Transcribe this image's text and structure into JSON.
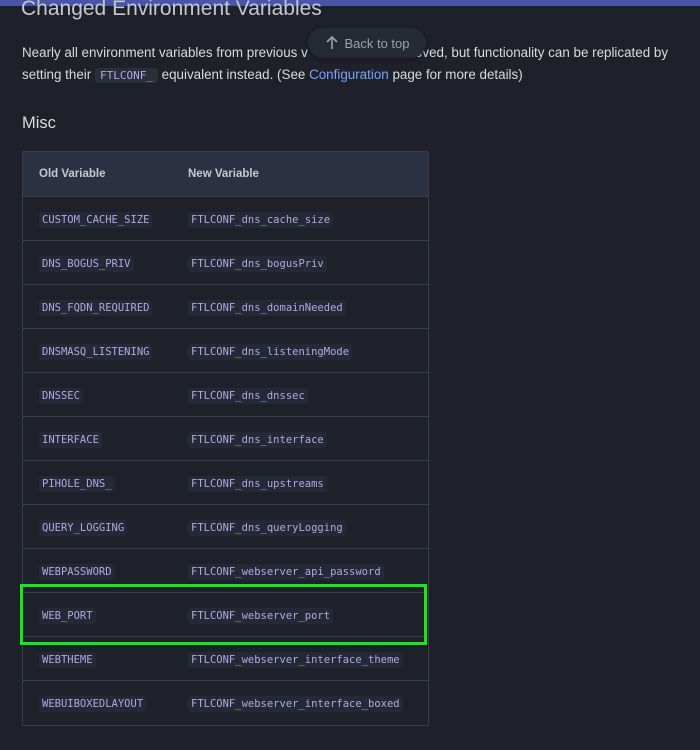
{
  "heading_partial": "Changed Environment Variables",
  "intro": {
    "text_before_code": "Nearly all environment variables from previous v",
    "text_hidden_tail": "moved, but functionality can be replicated by",
    "line2_prefix": "setting their ",
    "code": "FTLCONF_",
    "line2_mid": " equivalent instead. (See ",
    "link": "Configuration",
    "line2_suffix": " page for more details)"
  },
  "back_to_top": {
    "label": "Back to top",
    "icon": "arrow-up-icon"
  },
  "section_title": "Misc",
  "table": {
    "headers": [
      "Old Variable",
      "New Variable"
    ],
    "rows": [
      [
        "CUSTOM_CACHE_SIZE",
        "FTLCONF_dns_cache_size"
      ],
      [
        "DNS_BOGUS_PRIV",
        "FTLCONF_dns_bogusPriv"
      ],
      [
        "DNS_FQDN_REQUIRED",
        "FTLCONF_dns_domainNeeded"
      ],
      [
        "DNSMASQ_LISTENING",
        "FTLCONF_dns_listeningMode"
      ],
      [
        "DNSSEC",
        "FTLCONF_dns_dnssec"
      ],
      [
        "INTERFACE",
        "FTLCONF_dns_interface"
      ],
      [
        "PIHOLE_DNS_",
        "FTLCONF_dns_upstreams"
      ],
      [
        "QUERY_LOGGING",
        "FTLCONF_dns_queryLogging"
      ],
      [
        "WEBPASSWORD",
        "FTLCONF_webserver_api_password"
      ],
      [
        "WEB_PORT",
        "FTLCONF_webserver_port"
      ],
      [
        "WEBTHEME",
        "FTLCONF_webserver_interface_theme"
      ],
      [
        "WEBUIBOXEDLAYOUT",
        "FTLCONF_webserver_interface_boxed"
      ]
    ]
  },
  "colors": {
    "accent": "#4a55a8",
    "link": "#7aa2ff",
    "highlight": "#17e81a",
    "code": "#b5a6e2"
  }
}
